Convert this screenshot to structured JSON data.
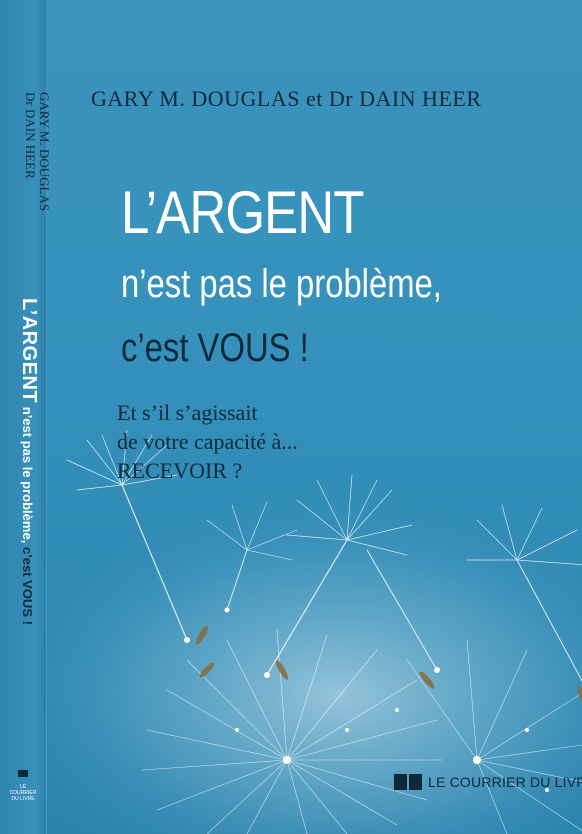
{
  "spine": {
    "author_1": "GARY M. DOUGLAS",
    "author_2": "Dr DAIN HEER",
    "title_big": "L’ARGENT",
    "title_rest": " n’est pas le problème, ",
    "title_dark": "c’est VOUS !",
    "publisher_line_1": "LE COURRIER",
    "publisher_line_2": "DU LIVRE"
  },
  "cover": {
    "authors": "GARY M. DOUGLAS et Dr DAIN HEER",
    "title_line_1": "L’ARGENT",
    "title_line_2": "n’est pas le problème,",
    "title_line_3": "c’est VOUS !",
    "subtitle_line_1": "Et s’il s’agissait",
    "subtitle_line_2": "de votre capacité à...",
    "subtitle_line_3": "RECEVOIR ?",
    "publisher": "LE COURRIER DU LIVRE"
  },
  "colors": {
    "background": "#3591bb",
    "dark_text": "#0e2a3a",
    "light_text": "#ffffff"
  }
}
